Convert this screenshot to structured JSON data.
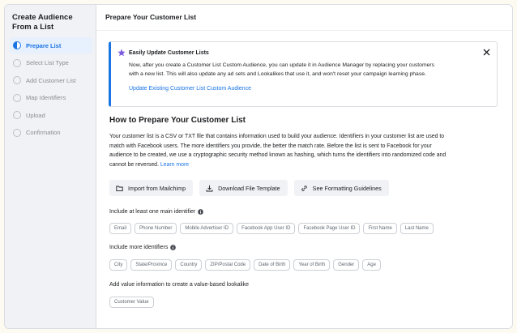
{
  "sidebar": {
    "title": "Create Audience From a List",
    "steps": [
      {
        "label": "Prepare List",
        "active": true
      },
      {
        "label": "Select List Type",
        "active": false
      },
      {
        "label": "Add Customer List",
        "active": false
      },
      {
        "label": "Map Identifiers",
        "active": false
      },
      {
        "label": "Upload",
        "active": false
      },
      {
        "label": "Confirmation",
        "active": false
      }
    ]
  },
  "main": {
    "page_title": "Prepare Your Customer List",
    "banner": {
      "title": "Easily Update Customer Lists",
      "line1": "Now, after you create a Customer List Custom Audience, you can update it in Audience Manager by replacing your customers",
      "line2": "with a new list. This will also update any ad sets and Lookalikes that use it, and won't reset your campaign learning phase.",
      "link": "Update Existing Customer List Custom Audience"
    },
    "section_title": "How to Prepare Your Customer List",
    "desc_lines": [
      "Your customer list is a CSV or TXT file that contains information used to build your audience. Identifiers in your customer list are used to",
      "match with Facebook users. The more identifiers you provide, the better the match rate. Before the list is sent to Facebook for your",
      "audience to be created, we use a cryptographic security method known as hashing, which turns the identifiers into randomized code and",
      "cannot be reversed."
    ],
    "learn_more": "Learn more",
    "buttons": {
      "import": "Import from Mailchimp",
      "download": "Download File Template",
      "formatting": "See Formatting Guidelines"
    },
    "main_identifier_label": "Include at least one main identifier",
    "main_identifiers": [
      "Email",
      "Phone Number",
      "Mobile Advertiser ID",
      "Facebook App User ID",
      "Facebook Page User ID",
      "First Name",
      "Last Name"
    ],
    "more_identifiers_label": "Include more identifiers",
    "more_identifiers": [
      "City",
      "State/Province",
      "Country",
      "ZIP/Postal Code",
      "Date of Birth",
      "Year of Birth",
      "Gender",
      "Age"
    ],
    "value_label": "Add value information to create a value-based lookalike",
    "value_identifiers": [
      "Customer Value"
    ]
  },
  "colors": {
    "accent": "#1b74e4",
    "sidebar_bg": "#f0f2f5",
    "page_bg": "#fdfaf2"
  }
}
